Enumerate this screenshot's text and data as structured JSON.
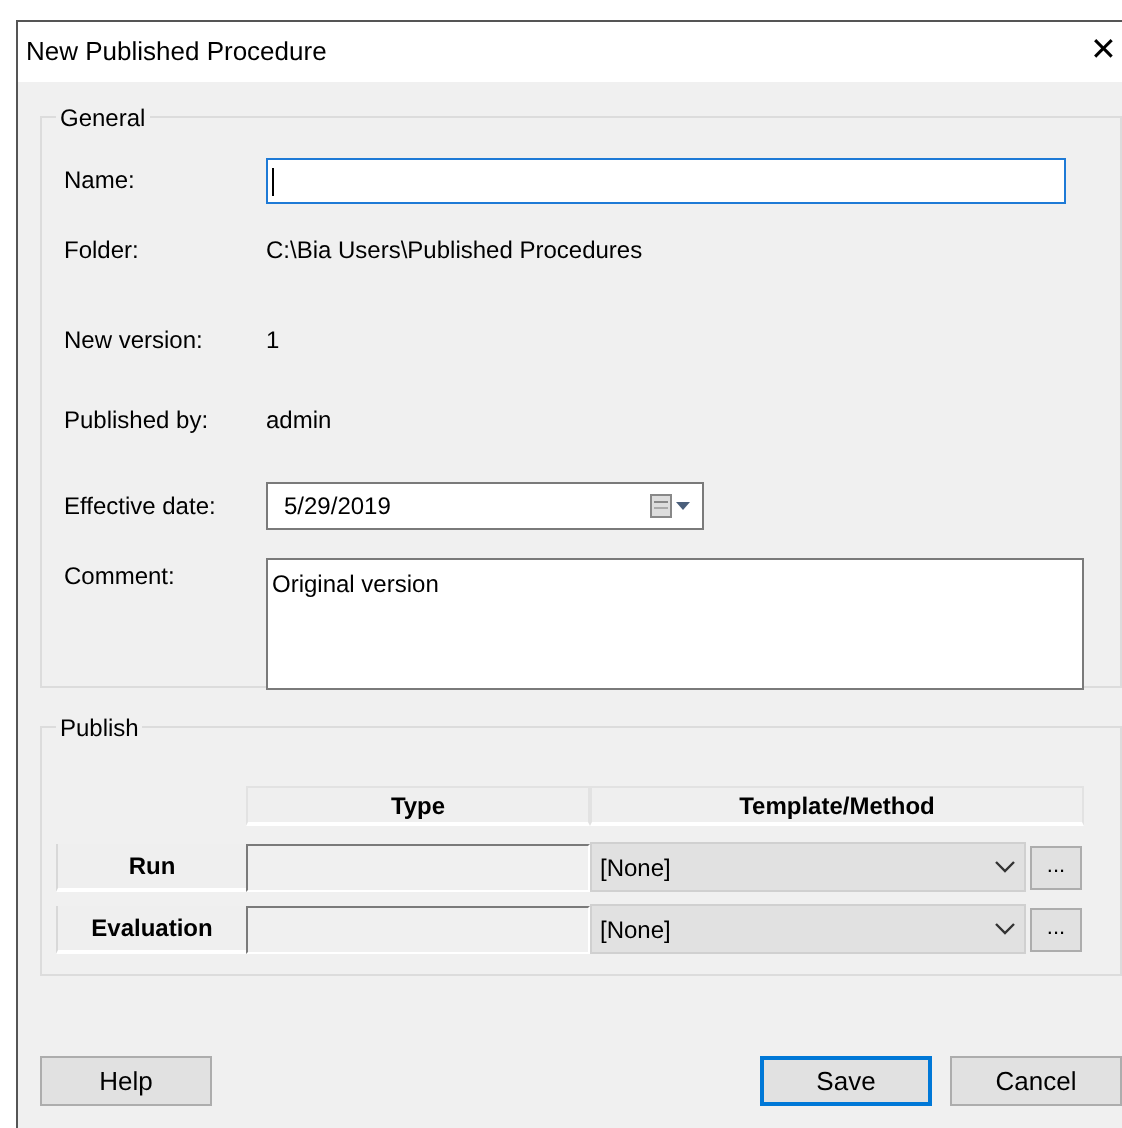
{
  "window": {
    "title": "New Published Procedure",
    "close": "✕"
  },
  "general": {
    "legend": "General",
    "fields": [
      {
        "kind": "input",
        "label": "Name:",
        "focused": true
      },
      {
        "kind": "static",
        "label": "Folder:",
        "value": "C:\\Bia Users\\Published Procedures"
      },
      {
        "kind": "static",
        "label": "New version:",
        "value": "1"
      },
      {
        "kind": "static",
        "label": "Published by:",
        "value": "admin"
      },
      {
        "kind": "date",
        "label": "Effective date:",
        "value": "5/29/2019"
      },
      {
        "kind": "textarea",
        "label": "Comment:",
        "value": "Original version"
      }
    ]
  },
  "publish": {
    "legend": "Publish",
    "columns": [
      "Type",
      "Template/Method"
    ],
    "rows": [
      {
        "label": "Run",
        "template": "[None]",
        "browse": "..."
      },
      {
        "label": "Evaluation",
        "template": "[None]",
        "browse": "..."
      }
    ]
  },
  "buttons": [
    {
      "label": "Help",
      "default": false
    },
    {
      "label": "Save",
      "default": true
    },
    {
      "label": "Cancel",
      "default": false
    }
  ]
}
